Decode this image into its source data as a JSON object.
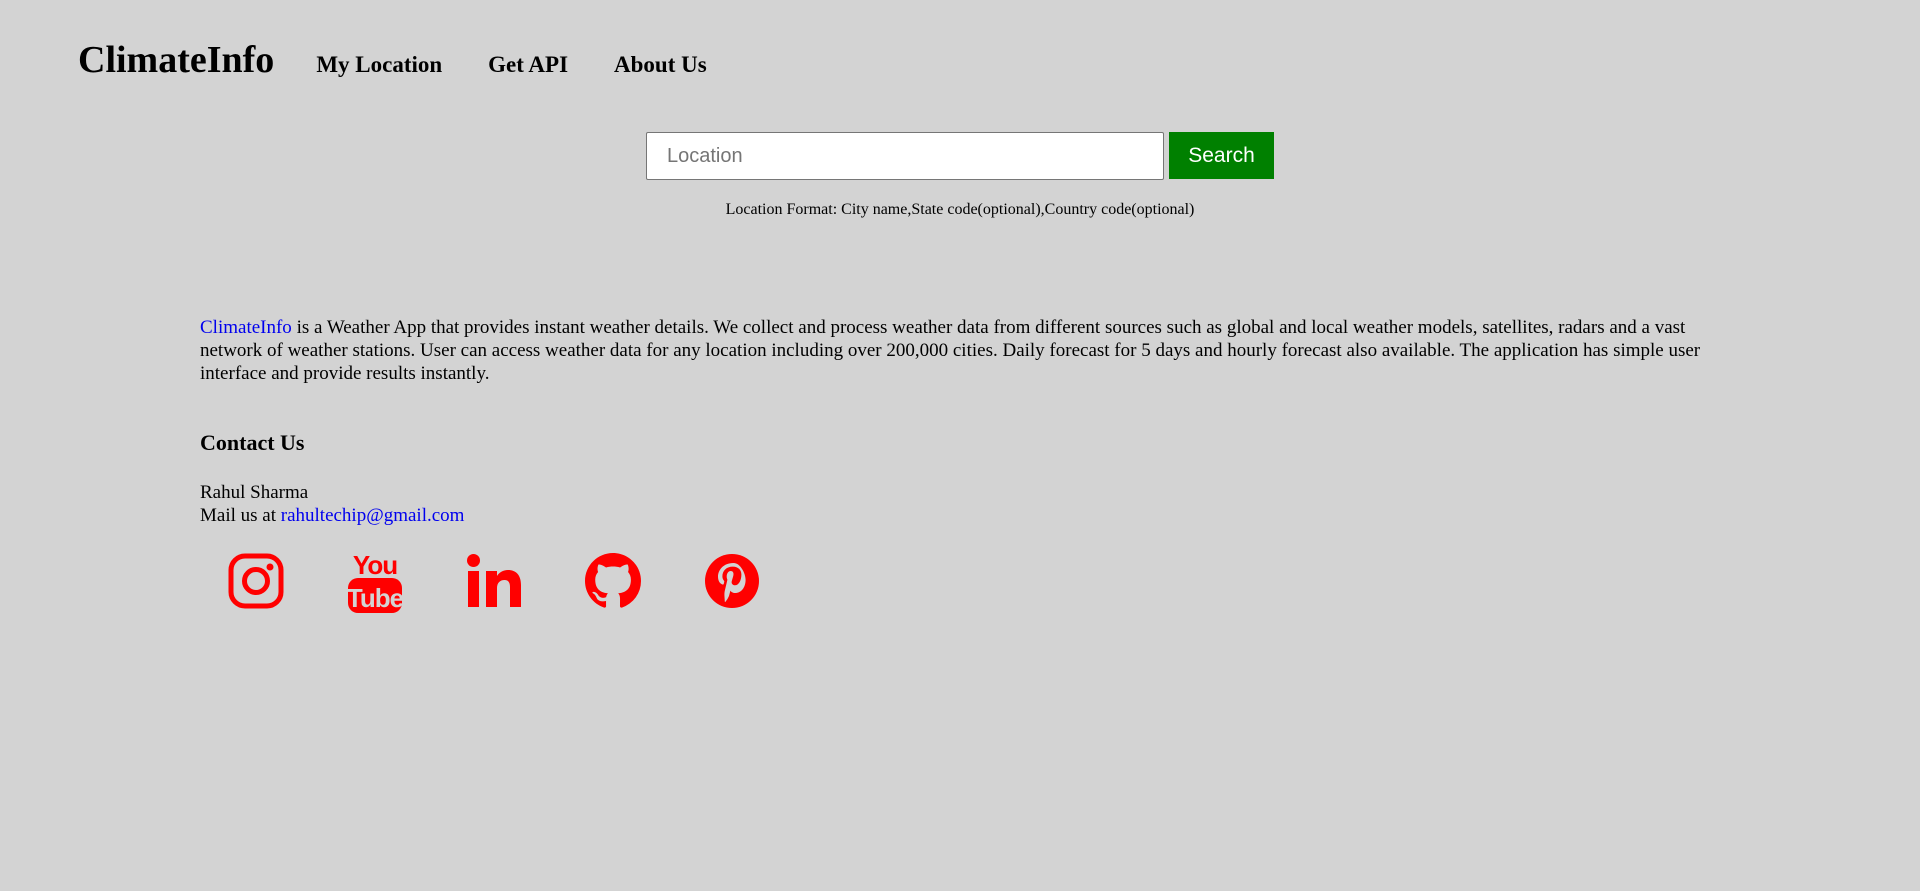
{
  "brand": "ClimateInfo",
  "nav": [
    {
      "label": "My Location"
    },
    {
      "label": "Get API"
    },
    {
      "label": "About Us"
    }
  ],
  "search": {
    "placeholder": "Location",
    "value": "",
    "button_label": "Search"
  },
  "hint": "Location Format: City name,State code(optional),Country code(optional)",
  "about": {
    "link_text": "ClimateInfo",
    "text": " is a Weather App that provides instant weather details. We collect and process weather data from different sources such as global and local weather models, satellites, radars and a vast network of weather stations. User can access weather data for any location including over 200,000 cities. Daily forecast for 5 days and hourly forecast also available. The application has simple user interface and provide results instantly."
  },
  "contact": {
    "title": "Contact Us",
    "name": "Rahul Sharma",
    "mail_prefix": "Mail us at ",
    "email": "rahultechip@gmail.com"
  },
  "socials": [
    {
      "icon": "instagram-icon"
    },
    {
      "icon": "youtube-icon"
    },
    {
      "icon": "linkedin-icon"
    },
    {
      "icon": "github-icon"
    },
    {
      "icon": "pinterest-icon"
    }
  ],
  "colors": {
    "background": "#d3d3d3",
    "search_button": "#008000",
    "social_icons": "#ff0000",
    "link": "#0000ee"
  }
}
